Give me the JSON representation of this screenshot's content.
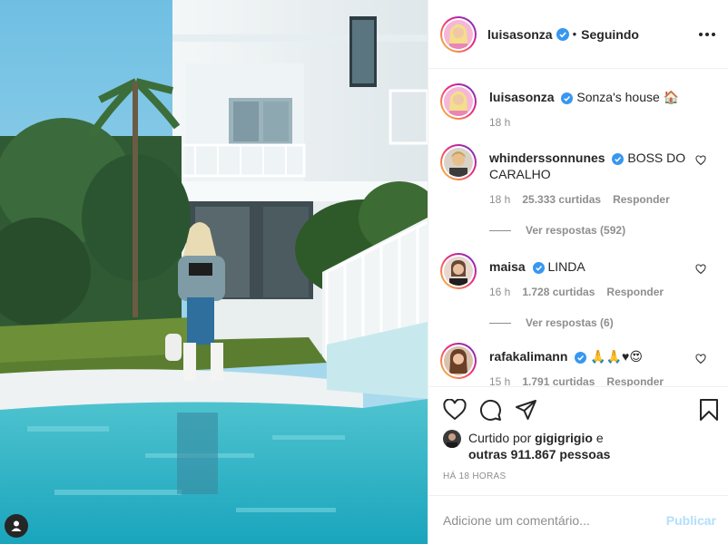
{
  "header": {
    "username": "luisasonza",
    "separator": "•",
    "follow_status": "Seguindo"
  },
  "caption": {
    "username": "luisasonza",
    "text": "Sonza's house 🏠",
    "time": "18 h"
  },
  "comments": [
    {
      "username": "whinderssonnunes",
      "text": "BOSS DO CARALHO",
      "time": "18 h",
      "likes": "25.333 curtidas",
      "reply": "Responder",
      "view_replies": "Ver respostas (592)"
    },
    {
      "username": "maisa",
      "text": "LINDA",
      "time": "16 h",
      "likes": "1.728 curtidas",
      "reply": "Responder",
      "view_replies": "Ver respostas (6)"
    },
    {
      "username": "rafakalimann",
      "text": "🙏🙏♥😍",
      "time": "15 h",
      "likes": "1.791 curtidas",
      "reply": "Responder"
    }
  ],
  "liked_by": {
    "prefix": "Curtido por",
    "user": "gigigrigio",
    "conj": "e",
    "others": "outras 911.867 pessoas"
  },
  "post_age": "HÁ 18 HORAS",
  "add_comment": {
    "placeholder": "Adicione um comentário...",
    "publish_label": "Publicar"
  },
  "icons": {
    "like": "heart-icon",
    "comment": "comment-icon",
    "share": "share-icon",
    "save": "bookmark-icon",
    "tag": "user-tag-icon",
    "more": "more-options-icon"
  },
  "colors": {
    "verified": "#3897f0",
    "muted": "#8e8e8e",
    "publish_disabled": "#b2dffc",
    "text": "#262626"
  }
}
